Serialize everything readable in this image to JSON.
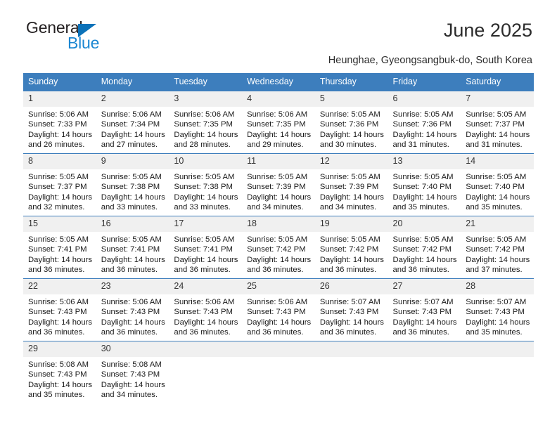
{
  "brand": {
    "name_part1": "General",
    "name_part2": "Blue",
    "triangle_color": "#0b72b9",
    "blue_color": "#1b87d2"
  },
  "header": {
    "title": "June 2025",
    "subtitle": "Heunghae, Gyeongsangbuk-do, South Korea"
  },
  "calendar": {
    "header_bg": "#3d7ebd",
    "header_text_color": "#ffffff",
    "daynum_bg": "#f0f0f0",
    "weekdays": [
      "Sunday",
      "Monday",
      "Tuesday",
      "Wednesday",
      "Thursday",
      "Friday",
      "Saturday"
    ],
    "weeks": [
      [
        {
          "day": "1",
          "sunrise": "Sunrise: 5:06 AM",
          "sunset": "Sunset: 7:33 PM",
          "daylight_line1": "Daylight: 14 hours",
          "daylight_line2": "and 26 minutes."
        },
        {
          "day": "2",
          "sunrise": "Sunrise: 5:06 AM",
          "sunset": "Sunset: 7:34 PM",
          "daylight_line1": "Daylight: 14 hours",
          "daylight_line2": "and 27 minutes."
        },
        {
          "day": "3",
          "sunrise": "Sunrise: 5:06 AM",
          "sunset": "Sunset: 7:35 PM",
          "daylight_line1": "Daylight: 14 hours",
          "daylight_line2": "and 28 minutes."
        },
        {
          "day": "4",
          "sunrise": "Sunrise: 5:06 AM",
          "sunset": "Sunset: 7:35 PM",
          "daylight_line1": "Daylight: 14 hours",
          "daylight_line2": "and 29 minutes."
        },
        {
          "day": "5",
          "sunrise": "Sunrise: 5:05 AM",
          "sunset": "Sunset: 7:36 PM",
          "daylight_line1": "Daylight: 14 hours",
          "daylight_line2": "and 30 minutes."
        },
        {
          "day": "6",
          "sunrise": "Sunrise: 5:05 AM",
          "sunset": "Sunset: 7:36 PM",
          "daylight_line1": "Daylight: 14 hours",
          "daylight_line2": "and 31 minutes."
        },
        {
          "day": "7",
          "sunrise": "Sunrise: 5:05 AM",
          "sunset": "Sunset: 7:37 PM",
          "daylight_line1": "Daylight: 14 hours",
          "daylight_line2": "and 31 minutes."
        }
      ],
      [
        {
          "day": "8",
          "sunrise": "Sunrise: 5:05 AM",
          "sunset": "Sunset: 7:37 PM",
          "daylight_line1": "Daylight: 14 hours",
          "daylight_line2": "and 32 minutes."
        },
        {
          "day": "9",
          "sunrise": "Sunrise: 5:05 AM",
          "sunset": "Sunset: 7:38 PM",
          "daylight_line1": "Daylight: 14 hours",
          "daylight_line2": "and 33 minutes."
        },
        {
          "day": "10",
          "sunrise": "Sunrise: 5:05 AM",
          "sunset": "Sunset: 7:38 PM",
          "daylight_line1": "Daylight: 14 hours",
          "daylight_line2": "and 33 minutes."
        },
        {
          "day": "11",
          "sunrise": "Sunrise: 5:05 AM",
          "sunset": "Sunset: 7:39 PM",
          "daylight_line1": "Daylight: 14 hours",
          "daylight_line2": "and 34 minutes."
        },
        {
          "day": "12",
          "sunrise": "Sunrise: 5:05 AM",
          "sunset": "Sunset: 7:39 PM",
          "daylight_line1": "Daylight: 14 hours",
          "daylight_line2": "and 34 minutes."
        },
        {
          "day": "13",
          "sunrise": "Sunrise: 5:05 AM",
          "sunset": "Sunset: 7:40 PM",
          "daylight_line1": "Daylight: 14 hours",
          "daylight_line2": "and 35 minutes."
        },
        {
          "day": "14",
          "sunrise": "Sunrise: 5:05 AM",
          "sunset": "Sunset: 7:40 PM",
          "daylight_line1": "Daylight: 14 hours",
          "daylight_line2": "and 35 minutes."
        }
      ],
      [
        {
          "day": "15",
          "sunrise": "Sunrise: 5:05 AM",
          "sunset": "Sunset: 7:41 PM",
          "daylight_line1": "Daylight: 14 hours",
          "daylight_line2": "and 36 minutes."
        },
        {
          "day": "16",
          "sunrise": "Sunrise: 5:05 AM",
          "sunset": "Sunset: 7:41 PM",
          "daylight_line1": "Daylight: 14 hours",
          "daylight_line2": "and 36 minutes."
        },
        {
          "day": "17",
          "sunrise": "Sunrise: 5:05 AM",
          "sunset": "Sunset: 7:41 PM",
          "daylight_line1": "Daylight: 14 hours",
          "daylight_line2": "and 36 minutes."
        },
        {
          "day": "18",
          "sunrise": "Sunrise: 5:05 AM",
          "sunset": "Sunset: 7:42 PM",
          "daylight_line1": "Daylight: 14 hours",
          "daylight_line2": "and 36 minutes."
        },
        {
          "day": "19",
          "sunrise": "Sunrise: 5:05 AM",
          "sunset": "Sunset: 7:42 PM",
          "daylight_line1": "Daylight: 14 hours",
          "daylight_line2": "and 36 minutes."
        },
        {
          "day": "20",
          "sunrise": "Sunrise: 5:05 AM",
          "sunset": "Sunset: 7:42 PM",
          "daylight_line1": "Daylight: 14 hours",
          "daylight_line2": "and 36 minutes."
        },
        {
          "day": "21",
          "sunrise": "Sunrise: 5:05 AM",
          "sunset": "Sunset: 7:42 PM",
          "daylight_line1": "Daylight: 14 hours",
          "daylight_line2": "and 37 minutes."
        }
      ],
      [
        {
          "day": "22",
          "sunrise": "Sunrise: 5:06 AM",
          "sunset": "Sunset: 7:43 PM",
          "daylight_line1": "Daylight: 14 hours",
          "daylight_line2": "and 36 minutes."
        },
        {
          "day": "23",
          "sunrise": "Sunrise: 5:06 AM",
          "sunset": "Sunset: 7:43 PM",
          "daylight_line1": "Daylight: 14 hours",
          "daylight_line2": "and 36 minutes."
        },
        {
          "day": "24",
          "sunrise": "Sunrise: 5:06 AM",
          "sunset": "Sunset: 7:43 PM",
          "daylight_line1": "Daylight: 14 hours",
          "daylight_line2": "and 36 minutes."
        },
        {
          "day": "25",
          "sunrise": "Sunrise: 5:06 AM",
          "sunset": "Sunset: 7:43 PM",
          "daylight_line1": "Daylight: 14 hours",
          "daylight_line2": "and 36 minutes."
        },
        {
          "day": "26",
          "sunrise": "Sunrise: 5:07 AM",
          "sunset": "Sunset: 7:43 PM",
          "daylight_line1": "Daylight: 14 hours",
          "daylight_line2": "and 36 minutes."
        },
        {
          "day": "27",
          "sunrise": "Sunrise: 5:07 AM",
          "sunset": "Sunset: 7:43 PM",
          "daylight_line1": "Daylight: 14 hours",
          "daylight_line2": "and 36 minutes."
        },
        {
          "day": "28",
          "sunrise": "Sunrise: 5:07 AM",
          "sunset": "Sunset: 7:43 PM",
          "daylight_line1": "Daylight: 14 hours",
          "daylight_line2": "and 35 minutes."
        }
      ],
      [
        {
          "day": "29",
          "sunrise": "Sunrise: 5:08 AM",
          "sunset": "Sunset: 7:43 PM",
          "daylight_line1": "Daylight: 14 hours",
          "daylight_line2": "and 35 minutes."
        },
        {
          "day": "30",
          "sunrise": "Sunrise: 5:08 AM",
          "sunset": "Sunset: 7:43 PM",
          "daylight_line1": "Daylight: 14 hours",
          "daylight_line2": "and 34 minutes."
        },
        {
          "day": "",
          "sunrise": "",
          "sunset": "",
          "daylight_line1": "",
          "daylight_line2": ""
        },
        {
          "day": "",
          "sunrise": "",
          "sunset": "",
          "daylight_line1": "",
          "daylight_line2": ""
        },
        {
          "day": "",
          "sunrise": "",
          "sunset": "",
          "daylight_line1": "",
          "daylight_line2": ""
        },
        {
          "day": "",
          "sunrise": "",
          "sunset": "",
          "daylight_line1": "",
          "daylight_line2": ""
        },
        {
          "day": "",
          "sunrise": "",
          "sunset": "",
          "daylight_line1": "",
          "daylight_line2": ""
        }
      ]
    ]
  }
}
